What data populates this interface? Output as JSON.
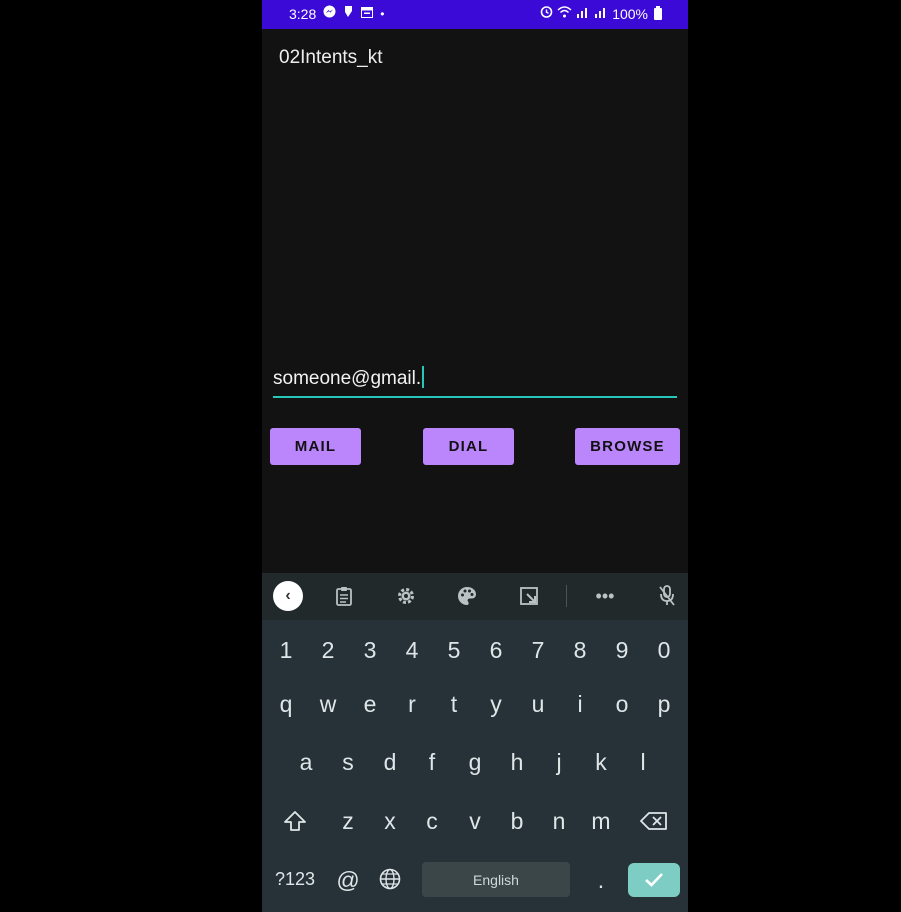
{
  "status_bar": {
    "time": "3:28",
    "battery": "100%",
    "left_icons": [
      "messenger-icon",
      "notification-icon",
      "calendar-icon",
      "dot-icon"
    ],
    "right_icons": [
      "alarm-icon",
      "wifi-icon",
      "signal-icon",
      "signal-icon",
      "battery-icon"
    ],
    "color": "#3b0ad6"
  },
  "app": {
    "title": "02Intents_kt",
    "email_value": "someone@gmail.",
    "accent": "#26c6b8",
    "buttons": {
      "mail": "MAIL",
      "dial": "DIAL",
      "browse": "BROWSE"
    },
    "button_color": "#bb86fc"
  },
  "keyboard": {
    "toolbar_icons": [
      "back-chevron-icon",
      "clipboard-icon",
      "settings-gear-icon",
      "palette-icon",
      "resize-icon",
      "more-icon",
      "mic-off-icon"
    ],
    "number_row": [
      "1",
      "2",
      "3",
      "4",
      "5",
      "6",
      "7",
      "8",
      "9",
      "0"
    ],
    "row1": [
      "q",
      "w",
      "e",
      "r",
      "t",
      "y",
      "u",
      "i",
      "o",
      "p"
    ],
    "row2": [
      "a",
      "s",
      "d",
      "f",
      "g",
      "h",
      "j",
      "k",
      "l"
    ],
    "row3": [
      "z",
      "x",
      "c",
      "v",
      "b",
      "n",
      "m"
    ],
    "symbols_label": "?123",
    "at_label": "@",
    "space_label": "English",
    "period_label": ".",
    "enter_color": "#7ecdc4"
  }
}
